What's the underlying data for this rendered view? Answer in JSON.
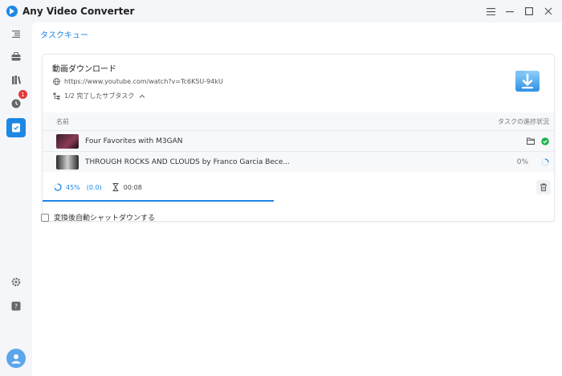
{
  "app": {
    "title": "Any Video Converter",
    "accent": "#1d87e4"
  },
  "window_controls": [
    "menu-icon",
    "minimize-icon",
    "maximize-icon",
    "close-icon"
  ],
  "sidebar": {
    "items": [
      {
        "name": "converter",
        "icon": "list-icon"
      },
      {
        "name": "toolbox",
        "icon": "toolbox-icon"
      },
      {
        "name": "library",
        "icon": "books-icon"
      },
      {
        "name": "history",
        "icon": "clock-icon",
        "badge": "1"
      },
      {
        "name": "task-queue",
        "icon": "task-icon",
        "active": true
      }
    ],
    "bottom": [
      {
        "name": "settings",
        "icon": "gear-icon"
      },
      {
        "name": "help",
        "icon": "help-icon"
      },
      {
        "name": "account",
        "icon": "avatar-icon"
      }
    ]
  },
  "page": {
    "title": "タスクキュー"
  },
  "task": {
    "title": "動画ダウンロード",
    "url": "https://www.youtube.com/watch?v=Tc6K5U-94kU",
    "subtask_summary": "1/2 完了したサブタスク",
    "table": {
      "col_name": "名前",
      "col_status": "タスクの進捗状況",
      "rows": [
        {
          "name": "Four Favorites with M3GAN",
          "status": "done",
          "percent": ""
        },
        {
          "name": "THROUGH ROCKS AND CLOUDS by Franco Garcia Bece...",
          "status": "downloading",
          "percent": "0%"
        }
      ]
    },
    "progress": {
      "percent_label": "45%",
      "speed": "(0.0)",
      "elapsed": "00:08",
      "fraction": 0.45
    }
  },
  "options": {
    "auto_shutdown_label": "変換後自動シャットダウンする",
    "auto_shutdown_checked": false
  }
}
